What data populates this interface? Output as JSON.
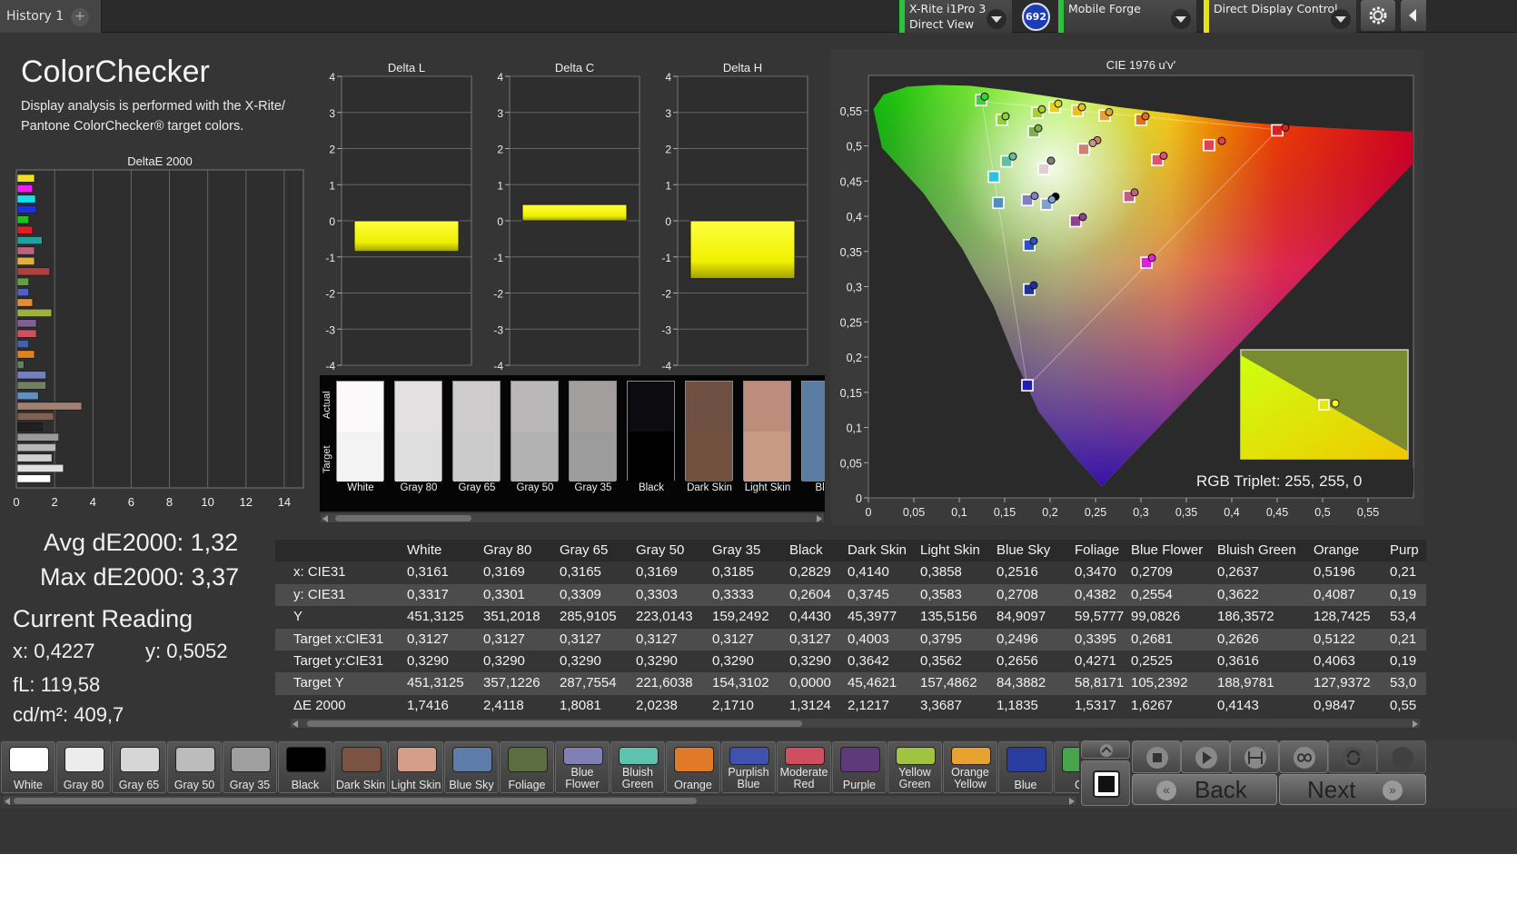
{
  "tabs": [
    {
      "label": "History 1"
    }
  ],
  "tab_add": "+",
  "devices": [
    {
      "line1": "X-Rite i1Pro 3",
      "line2": "Direct View",
      "color": "#2ac33a"
    },
    {
      "line1": "Mobile Forge",
      "line2": "",
      "color": "#2ac33a"
    },
    {
      "line1": "Direct Display Control",
      "line2": "",
      "color": "#e8e21b"
    }
  ],
  "badge": "692",
  "header": {
    "title": "ColorChecker",
    "description": "Display analysis is performed with the X-Rite/ Pantone ColorChecker® target colors."
  },
  "stats": {
    "avg": "Avg dE2000: 1,32",
    "max": "Max dE2000: 3,37",
    "current_reading": "Current Reading",
    "x": "x: 0,4227",
    "y": "y: 0,5052",
    "fl": "fL: 119,58",
    "cdm2": "cd/m²: 409,7"
  },
  "rgb_triplet": "RGB Triplet: 255, 255, 0",
  "patch_labels": {
    "actual": "Actual",
    "target": "Target"
  },
  "nav": {
    "back": "Back",
    "next": "Next"
  },
  "colors": {
    "highlight": "#ffff00",
    "accent_green": "#2ac33a"
  },
  "chart_data": [
    {
      "type": "bar",
      "orientation": "horizontal",
      "title": "DeltaE 2000",
      "xlim": [
        0,
        15
      ],
      "xticks": [
        "0",
        "2",
        "4",
        "6",
        "8",
        "10",
        "12",
        "14"
      ],
      "bars": [
        {
          "value": 0.9,
          "color": "#f0e020"
        },
        {
          "value": 0.8,
          "color": "#f020f0"
        },
        {
          "value": 0.95,
          "color": "#10e0f0"
        },
        {
          "value": 1.0,
          "color": "#2030e0"
        },
        {
          "value": 0.6,
          "color": "#20c020"
        },
        {
          "value": 0.8,
          "color": "#e02020"
        },
        {
          "value": 1.3,
          "color": "#20a0a0"
        },
        {
          "value": 0.9,
          "color": "#c06080"
        },
        {
          "value": 0.9,
          "color": "#e0b040"
        },
        {
          "value": 1.7,
          "color": "#b04040"
        },
        {
          "value": 0.6,
          "color": "#60a040"
        },
        {
          "value": 0.6,
          "color": "#5060c0"
        },
        {
          "value": 0.8,
          "color": "#e09030"
        },
        {
          "value": 1.8,
          "color": "#a0b040"
        },
        {
          "value": 1.0,
          "color": "#806090"
        },
        {
          "value": 1.0,
          "color": "#d05060"
        },
        {
          "value": 0.6,
          "color": "#4060b0"
        },
        {
          "value": 0.9,
          "color": "#e08020"
        },
        {
          "value": 0.35,
          "color": "#608060"
        },
        {
          "value": 1.5,
          "color": "#7080c0"
        },
        {
          "value": 1.5,
          "color": "#708060"
        },
        {
          "value": 1.1,
          "color": "#6090c0"
        },
        {
          "value": 3.37,
          "color": "#a08070"
        },
        {
          "value": 1.9,
          "color": "#806050"
        },
        {
          "value": 1.3,
          "color": "#202020"
        },
        {
          "value": 2.17,
          "color": "#9a9a9a"
        },
        {
          "value": 2.02,
          "color": "#b8b8b8"
        },
        {
          "value": 1.81,
          "color": "#d0d0d0"
        },
        {
          "value": 2.41,
          "color": "#e0e0e0"
        },
        {
          "value": 1.74,
          "color": "#ffffff"
        }
      ]
    },
    {
      "type": "bar",
      "title": "Delta L",
      "ylim": [
        -4,
        4
      ],
      "yticks": [
        "4",
        "3",
        "2",
        "1",
        "0",
        "-1",
        "-2",
        "-3",
        "-4"
      ],
      "values": [
        -0.85
      ]
    },
    {
      "type": "bar",
      "title": "Delta C",
      "ylim": [
        -4,
        4
      ],
      "yticks": [
        "4",
        "3",
        "2",
        "1",
        "0",
        "-1",
        "-2",
        "-3",
        "-4"
      ],
      "values": [
        0.45
      ]
    },
    {
      "type": "bar",
      "title": "Delta H",
      "ylim": [
        -4,
        4
      ],
      "yticks": [
        "4",
        "3",
        "2",
        "1",
        "0",
        "-1",
        "-2",
        "-3",
        "-4"
      ],
      "values": [
        -1.6
      ]
    },
    {
      "type": "scatter",
      "title": "CIE 1976 u'v'",
      "xlim": [
        0,
        0.6
      ],
      "ylim": [
        0,
        0.6
      ],
      "xticks": [
        "0",
        "0,05",
        "0,1",
        "0,15",
        "0,2",
        "0,25",
        "0,3",
        "0,35",
        "0,4",
        "0,45",
        "0,5",
        "0,55"
      ],
      "yticks": [
        "0",
        "0,05",
        "0,1",
        "0,15",
        "0,2",
        "0,25",
        "0,3",
        "0,35",
        "0,4",
        "0,45",
        "0,5",
        "0,55"
      ],
      "targets": [
        {
          "u": 0.124,
          "v": 0.565,
          "color": "#3cd040"
        },
        {
          "u": 0.147,
          "v": 0.537,
          "color": "#90d040"
        },
        {
          "u": 0.186,
          "v": 0.547,
          "color": "#a8d030"
        },
        {
          "u": 0.205,
          "v": 0.555,
          "color": "#e8d020"
        },
        {
          "u": 0.23,
          "v": 0.55,
          "color": "#e8c020"
        },
        {
          "u": 0.26,
          "v": 0.543,
          "color": "#e8a030"
        },
        {
          "u": 0.3,
          "v": 0.537,
          "color": "#e07020"
        },
        {
          "u": 0.45,
          "v": 0.522,
          "color": "#e02020"
        },
        {
          "u": 0.375,
          "v": 0.501,
          "color": "#e04050"
        },
        {
          "u": 0.318,
          "v": 0.48,
          "color": "#e05070"
        },
        {
          "u": 0.237,
          "v": 0.495,
          "color": "#d08070"
        },
        {
          "u": 0.193,
          "v": 0.467,
          "color": "#e0d0d0"
        },
        {
          "u": 0.182,
          "v": 0.52,
          "color": "#80b050"
        },
        {
          "u": 0.152,
          "v": 0.478,
          "color": "#60c0a0"
        },
        {
          "u": 0.138,
          "v": 0.456,
          "color": "#30c0e0"
        },
        {
          "u": 0.143,
          "v": 0.419,
          "color": "#5090c0"
        },
        {
          "u": 0.175,
          "v": 0.423,
          "color": "#8080c0"
        },
        {
          "u": 0.196,
          "v": 0.417,
          "color": "#80a0d0"
        },
        {
          "u": 0.228,
          "v": 0.393,
          "color": "#904090"
        },
        {
          "u": 0.287,
          "v": 0.428,
          "color": "#c06080"
        },
        {
          "u": 0.177,
          "v": 0.359,
          "color": "#3050c0"
        },
        {
          "u": 0.177,
          "v": 0.296,
          "color": "#2030a0"
        },
        {
          "u": 0.306,
          "v": 0.334,
          "color": "#e020e0"
        },
        {
          "u": 0.175,
          "v": 0.16,
          "color": "#2020b0"
        }
      ],
      "actuals": [
        {
          "u": 0.125,
          "v": 0.566,
          "color": "#3cd040"
        },
        {
          "u": 0.148,
          "v": 0.538,
          "color": "#90d040"
        },
        {
          "u": 0.188,
          "v": 0.548,
          "color": "#a8d030"
        },
        {
          "u": 0.206,
          "v": 0.556,
          "color": "#e8d020"
        },
        {
          "u": 0.232,
          "v": 0.551,
          "color": "#e8c020"
        },
        {
          "u": 0.262,
          "v": 0.544,
          "color": "#e8a030"
        },
        {
          "u": 0.302,
          "v": 0.538,
          "color": "#e07020"
        },
        {
          "u": 0.456,
          "v": 0.522,
          "color": "#e02020"
        },
        {
          "u": 0.386,
          "v": 0.503,
          "color": "#e04050"
        },
        {
          "u": 0.322,
          "v": 0.482,
          "color": "#e05070"
        },
        {
          "u": 0.249,
          "v": 0.504,
          "color": "#d08070"
        },
        {
          "u": 0.244,
          "v": 0.5,
          "color": "#d09080"
        },
        {
          "u": 0.184,
          "v": 0.521,
          "color": "#80b050"
        },
        {
          "u": 0.156,
          "v": 0.481,
          "color": "#60c0a0"
        },
        {
          "u": 0.203,
          "v": 0.424,
          "color": "#000000"
        },
        {
          "u": 0.18,
          "v": 0.425,
          "color": "#8080c0"
        },
        {
          "u": 0.199,
          "v": 0.42,
          "color": "#80a0d0"
        },
        {
          "u": 0.233,
          "v": 0.395,
          "color": "#904090"
        },
        {
          "u": 0.29,
          "v": 0.43,
          "color": "#c06080"
        },
        {
          "u": 0.179,
          "v": 0.361,
          "color": "#3050c0"
        },
        {
          "u": 0.179,
          "v": 0.298,
          "color": "#2030a0"
        },
        {
          "u": 0.309,
          "v": 0.337,
          "color": "#e020e0"
        },
        {
          "u": 0.198,
          "v": 0.475,
          "color": "#808080"
        }
      ],
      "inset": {
        "target": {
          "u": 0.2,
          "v": 0.56
        },
        "actual": {
          "u": 0.202,
          "v": 0.559
        }
      }
    },
    {
      "type": "table",
      "columns": [
        "",
        "White",
        "Gray 80",
        "Gray 65",
        "Gray 50",
        "Gray 35",
        "Black",
        "Dark Skin",
        "Light Skin",
        "Blue Sky",
        "Foliage",
        "Blue Flower",
        "Bluish Green",
        "Orange",
        "Purp"
      ],
      "rows": [
        [
          "x: CIE31",
          "0,3161",
          "0,3169",
          "0,3165",
          "0,3169",
          "0,3185",
          "0,2829",
          "0,4140",
          "0,3858",
          "0,2516",
          "0,3470",
          "0,2709",
          "0,2637",
          "0,5196",
          "0,21"
        ],
        [
          "y: CIE31",
          "0,3317",
          "0,3301",
          "0,3309",
          "0,3303",
          "0,3333",
          "0,2604",
          "0,3745",
          "0,3583",
          "0,2708",
          "0,4382",
          "0,2554",
          "0,3622",
          "0,4087",
          "0,19"
        ],
        [
          "Y",
          "451,3125",
          "351,2018",
          "285,9105",
          "223,0143",
          "159,2492",
          "0,4430",
          "45,3977",
          "135,5156",
          "84,9097",
          "59,5777",
          "99,0826",
          "186,3572",
          "128,7425",
          "53,4"
        ],
        [
          "Target x:CIE31",
          "0,3127",
          "0,3127",
          "0,3127",
          "0,3127",
          "0,3127",
          "0,3127",
          "0,4003",
          "0,3795",
          "0,2496",
          "0,3395",
          "0,2681",
          "0,2626",
          "0,5122",
          "0,21"
        ],
        [
          "Target y:CIE31",
          "0,3290",
          "0,3290",
          "0,3290",
          "0,3290",
          "0,3290",
          "0,3290",
          "0,3642",
          "0,3562",
          "0,2656",
          "0,4271",
          "0,2525",
          "0,3616",
          "0,4063",
          "0,19"
        ],
        [
          "Target Y",
          "451,3125",
          "357,1226",
          "287,7554",
          "221,6038",
          "154,3102",
          "0,0000",
          "45,4621",
          "157,4862",
          "84,3882",
          "58,8171",
          "105,2392",
          "188,9781",
          "127,9372",
          "53,0"
        ],
        [
          "ΔE 2000",
          "1,7416",
          "2,4118",
          "1,8081",
          "2,0238",
          "2,1710",
          "1,3124",
          "2,1217",
          "3,3687",
          "1,1835",
          "1,5317",
          "1,6267",
          "0,4143",
          "0,9847",
          "0,55"
        ]
      ]
    }
  ],
  "patches": [
    {
      "label": "White",
      "actual": "#fbf9f9",
      "target": "#f3f3f3"
    },
    {
      "label": "Gray 80",
      "actual": "#e4dfe0",
      "target": "#dedede"
    },
    {
      "label": "Gray 65",
      "actual": "#cdcbcc",
      "target": "#cbcbcb"
    },
    {
      "label": "Gray 50",
      "actual": "#b9b7b8",
      "target": "#b2b2b2"
    },
    {
      "label": "Gray 35",
      "actual": "#a19e9d",
      "target": "#9c9c9c"
    },
    {
      "label": "Black",
      "actual": "#0c0c10",
      "target": "#000000"
    },
    {
      "label": "Dark Skin",
      "actual": "#6f4f41",
      "target": "#725141"
    },
    {
      "label": "Light Skin",
      "actual": "#bd8c7b",
      "target": "#c79a84"
    },
    {
      "label": "Blue",
      "actual": "#5b7ca3",
      "target": "#5b7ca3"
    }
  ],
  "bottom_patches": [
    {
      "label": "White",
      "color": "#ffffff"
    },
    {
      "label": "Gray 80",
      "color": "#ececec"
    },
    {
      "label": "Gray 65",
      "color": "#d6d6d6"
    },
    {
      "label": "Gray 50",
      "color": "#bcbcbc"
    },
    {
      "label": "Gray 35",
      "color": "#9f9f9f"
    },
    {
      "label": "Black",
      "color": "#000000"
    },
    {
      "label": "Dark Skin",
      "color": "#7a5343"
    },
    {
      "label": "Light Skin",
      "color": "#d49d87"
    },
    {
      "label": "Blue Sky",
      "color": "#5d7ca9"
    },
    {
      "label": "Foliage",
      "color": "#5c6e3f"
    },
    {
      "label": "Blue Flower",
      "color": "#8180b4"
    },
    {
      "label": "Bluish Green",
      "color": "#5fc2ae"
    },
    {
      "label": "Orange",
      "color": "#e07a28"
    },
    {
      "label": "Purplish Blue",
      "color": "#3e52ae"
    },
    {
      "label": "Moderate Red",
      "color": "#cf4f5f"
    },
    {
      "label": "Purple",
      "color": "#5e3a7a"
    },
    {
      "label": "Yellow Green",
      "color": "#a2c33f"
    },
    {
      "label": "Orange Yellow",
      "color": "#e8a22f"
    },
    {
      "label": "Blue",
      "color": "#2a3d9e"
    },
    {
      "label": "Gr",
      "color": "#47a44a"
    }
  ]
}
